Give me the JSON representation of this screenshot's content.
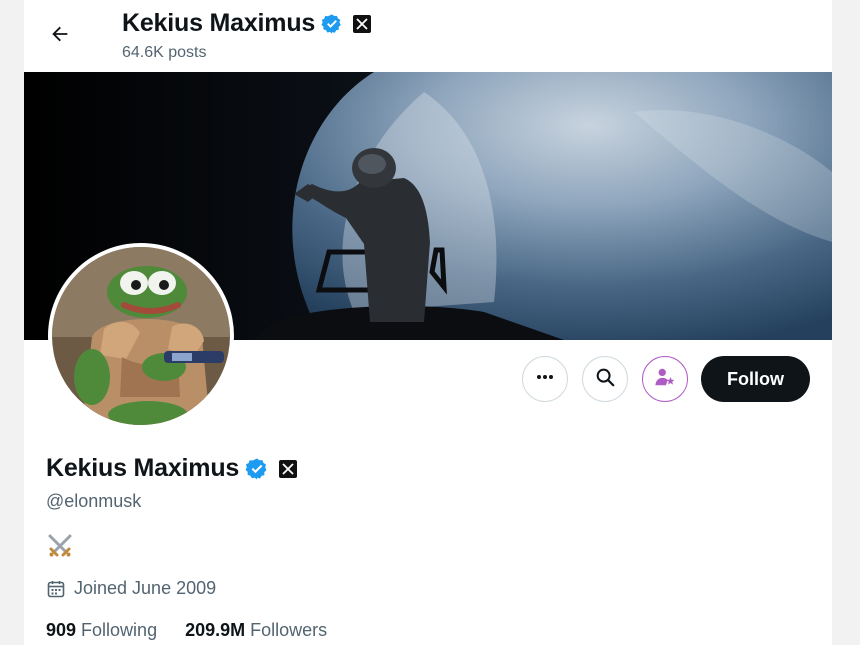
{
  "header": {
    "back_icon": "arrow-left-icon",
    "name": "Kekius Maximus",
    "posts": "64.6K posts"
  },
  "profile": {
    "name": "Kekius Maximus",
    "handle": "@elonmusk",
    "bio_emoji": "crossed-swords",
    "joined": "Joined June 2009",
    "following_count": "909",
    "following_label": "Following",
    "followers_count": "209.9M",
    "followers_label": "Followers"
  },
  "actions": {
    "more_icon": "more-icon",
    "search_icon": "search-icon",
    "subscribe_icon": "subscribe-icon",
    "follow_label": "Follow"
  },
  "colors": {
    "verified": "#1d9bf0",
    "follow_bg": "#0f1419",
    "subscribe_accent": "#b05cc5",
    "muted_text": "#536471"
  }
}
